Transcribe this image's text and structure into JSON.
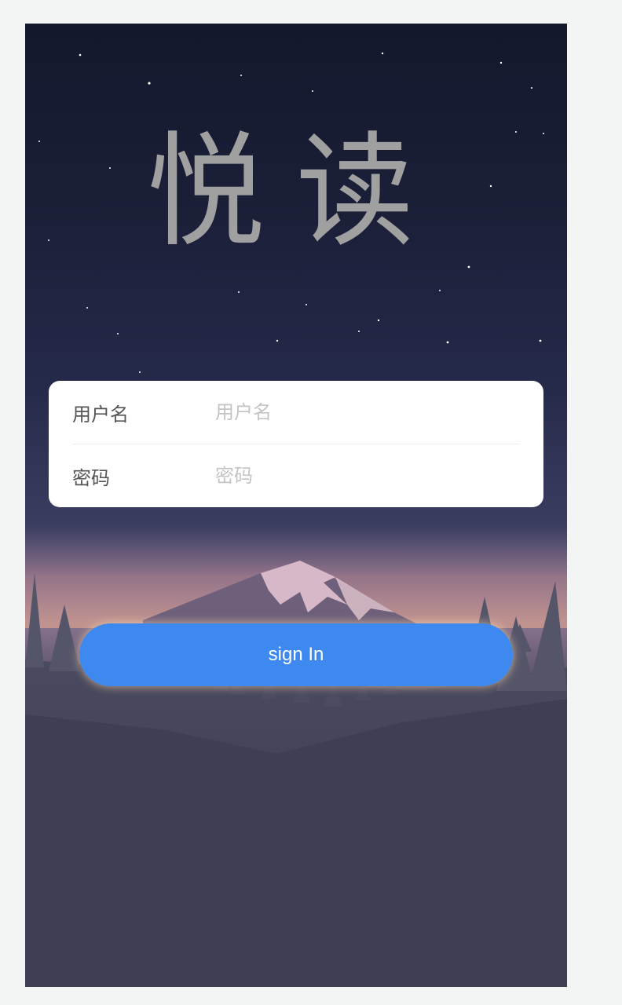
{
  "app": {
    "logo_text": "悦读"
  },
  "form": {
    "username_label": "用户名",
    "username_placeholder": "用户名",
    "username_value": "",
    "password_label": "密码",
    "password_placeholder": "密码",
    "password_value": ""
  },
  "actions": {
    "signin_label": "sign In"
  },
  "colors": {
    "page_background": "#f3f4f4",
    "night_sky_top": "#13182c",
    "horizon_glow": "#8a7590",
    "ground": "#353549",
    "logo": "#a0a0a0",
    "card": "#ffffff",
    "button": "#3d89f0",
    "button_text": "#ffffff"
  }
}
